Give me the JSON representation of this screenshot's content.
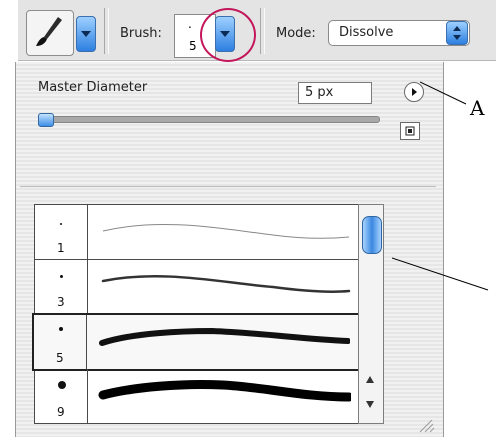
{
  "toolbar": {
    "tool_icon": "brush-icon",
    "brush_label": "Brush:",
    "brush_size_top": ".",
    "brush_size_bottom": "5",
    "mode_label": "Mode:",
    "mode_value": "Dissolve"
  },
  "panel": {
    "master_diameter_label": "Master Diameter",
    "diameter_value": "5 px",
    "callouts": {
      "a": "A"
    },
    "brushes": [
      {
        "size": "1",
        "selected": false
      },
      {
        "size": "3",
        "selected": false
      },
      {
        "size": "5",
        "selected": true
      },
      {
        "size": "9",
        "selected": false
      }
    ]
  },
  "colors": {
    "accent_circle": "#c2185b",
    "aqua_blue": "#2d7fe0"
  }
}
